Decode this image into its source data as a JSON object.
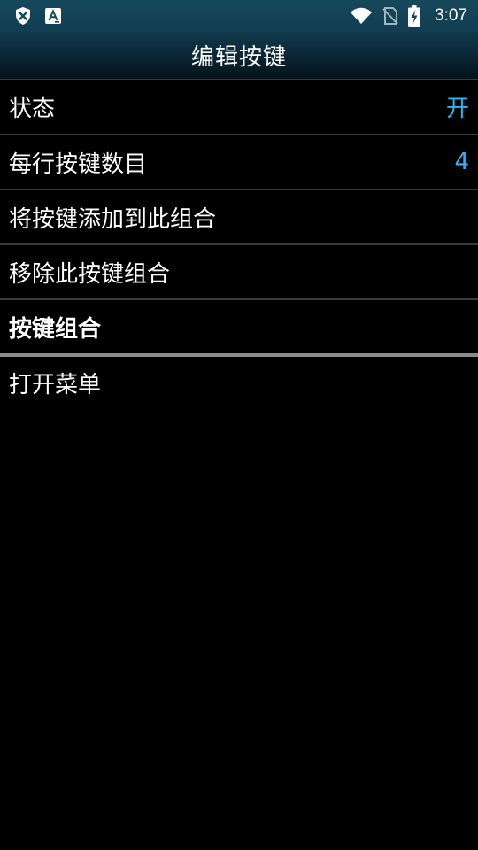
{
  "status_bar": {
    "time": "3:07",
    "icons": [
      "shield-x-icon",
      "font-a-icon",
      "wifi-icon",
      "no-sim-icon",
      "battery-charging-icon"
    ]
  },
  "title_bar": {
    "title": "编辑按键"
  },
  "list": {
    "items": [
      {
        "label": "状态",
        "value": "开"
      },
      {
        "label": "每行按键数目",
        "value": "4"
      },
      {
        "label": "将按键添加到此组合"
      },
      {
        "label": "移除此按键组合"
      },
      {
        "label": "按键组合"
      },
      {
        "label": "打开菜单"
      }
    ]
  },
  "colors": {
    "accent": "#2fb3f0",
    "status_bar": "#16485c",
    "background": "#000000"
  }
}
